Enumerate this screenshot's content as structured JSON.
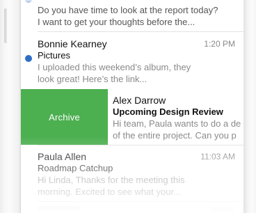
{
  "messages": [
    {
      "sender": "",
      "subject": "",
      "preview_line1": "Do you have time to look at the report today?",
      "preview_line2": "I want to get your thoughts before the...",
      "time": "",
      "unread": true
    },
    {
      "sender": "Bonnie Kearney",
      "subject": "Pictures",
      "preview_line1": "I uploaded this weekend’s album, they",
      "preview_line2": "look great! Here’s the link...",
      "time": "1:20 PM",
      "unread": true
    },
    {
      "sender": "Alex Darrow",
      "subject": "Upcoming Design Review",
      "preview_line1": "Hi team, Paula wants to do a de",
      "preview_line2": "of the entire project. Can you p",
      "time": "",
      "unread": false
    },
    {
      "sender": "Paula Allen",
      "subject": "Roadmap Catchup",
      "preview_line1": "Hi Linda, Thanks for the meeting this",
      "preview_line2": "morning. Excited to see what your...",
      "time": "11:03 AM",
      "unread": false
    }
  ],
  "swipe_action": {
    "label": "Archive",
    "color": "#4caf50"
  },
  "colors": {
    "unread_dot": "#2d6fc6",
    "sender_text": "#111111",
    "preview_text": "#8a8a8a"
  }
}
